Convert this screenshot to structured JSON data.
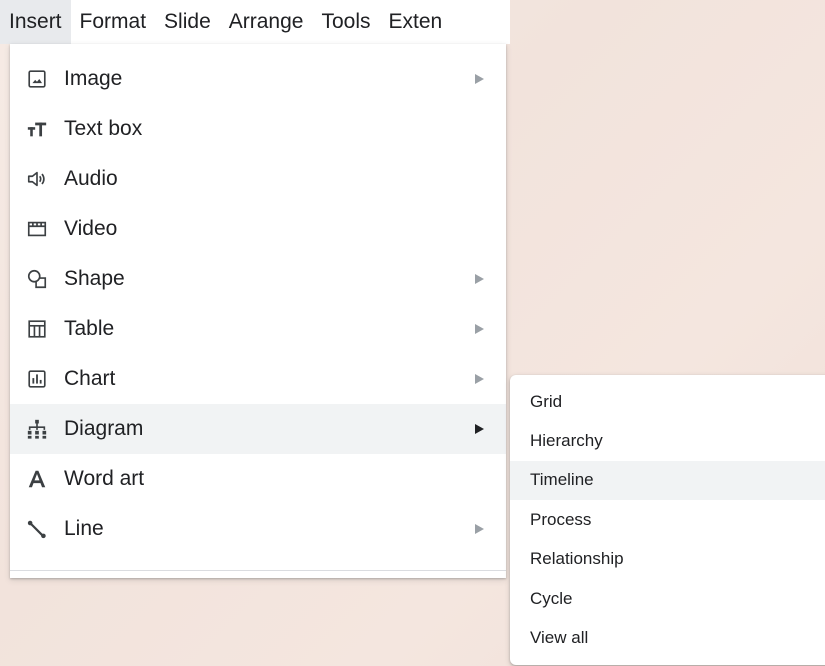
{
  "menubar": {
    "items": [
      {
        "label": "Insert",
        "active": true
      },
      {
        "label": "Format"
      },
      {
        "label": "Slide"
      },
      {
        "label": "Arrange"
      },
      {
        "label": "Tools"
      },
      {
        "label": "Exten"
      }
    ]
  },
  "insert_menu": {
    "items": [
      {
        "label": "Image",
        "icon": "image-icon",
        "has_submenu": true
      },
      {
        "label": "Text box",
        "icon": "text-box-icon",
        "has_submenu": false
      },
      {
        "label": "Audio",
        "icon": "audio-icon",
        "has_submenu": false
      },
      {
        "label": "Video",
        "icon": "video-icon",
        "has_submenu": false
      },
      {
        "label": "Shape",
        "icon": "shape-icon",
        "has_submenu": true
      },
      {
        "label": "Table",
        "icon": "table-icon",
        "has_submenu": true
      },
      {
        "label": "Chart",
        "icon": "chart-icon",
        "has_submenu": true
      },
      {
        "label": "Diagram",
        "icon": "diagram-icon",
        "has_submenu": true,
        "highlighted": true
      },
      {
        "label": "Word art",
        "icon": "word-art-icon",
        "has_submenu": false
      },
      {
        "label": "Line",
        "icon": "line-icon",
        "has_submenu": true
      }
    ]
  },
  "diagram_submenu": {
    "items": [
      {
        "label": "Grid"
      },
      {
        "label": "Hierarchy"
      },
      {
        "label": "Timeline",
        "highlighted": true
      },
      {
        "label": "Process"
      },
      {
        "label": "Relationship"
      },
      {
        "label": "Cycle"
      },
      {
        "label": "View all"
      }
    ]
  },
  "colors": {
    "hover_bg": "#f1f3f4",
    "active_menubar_bg": "#e8eaed",
    "text": "#202124",
    "icon": "#3c4043",
    "arrow": "#9aa0a6"
  }
}
